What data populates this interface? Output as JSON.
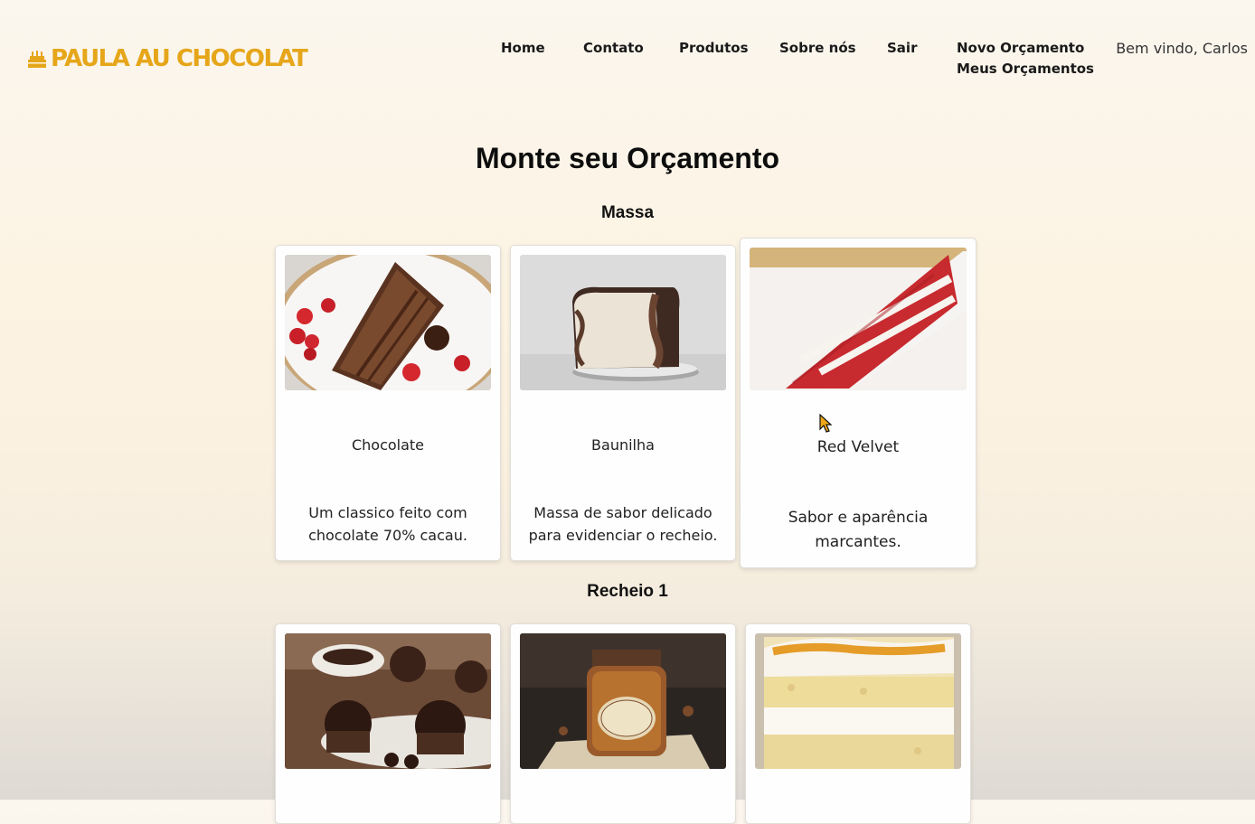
{
  "brand": {
    "name": "PAULA AU CHOCOLAT",
    "icon": "cake-icon",
    "color": "#e6a61a"
  },
  "nav": {
    "home": "Home",
    "contato": "Contato",
    "produtos": "Produtos",
    "sobre": "Sobre nós",
    "sair": "Sair",
    "novo_orcamento": "Novo Orçamento",
    "meus_orcamentos": "Meus Orçamentos"
  },
  "user": {
    "welcome": "Bem vindo, Carlos"
  },
  "page": {
    "title": "Monte seu Orçamento"
  },
  "sections": [
    {
      "title": "Massa",
      "items": [
        {
          "name": "Chocolate",
          "description": "Um classico feito com chocolate 70% cacau.",
          "image": "chocolate-cake-slice-image"
        },
        {
          "name": "Baunilha",
          "description": "Massa de sabor delicado para evidenciar o recheio.",
          "image": "vanilla-marble-cake-slice-image"
        },
        {
          "name": "Red Velvet",
          "description": "Sabor e aparência marcantes.",
          "image": "red-velvet-cake-slice-image",
          "hovered": true
        }
      ]
    },
    {
      "title": "Recheio 1",
      "items": [
        {
          "name": "",
          "image": "brigadeiro-truffles-image"
        },
        {
          "name": "",
          "image": "doce-de-leite-jar-image"
        },
        {
          "name": "",
          "image": "coconut-cake-slice-image"
        }
      ]
    }
  ]
}
